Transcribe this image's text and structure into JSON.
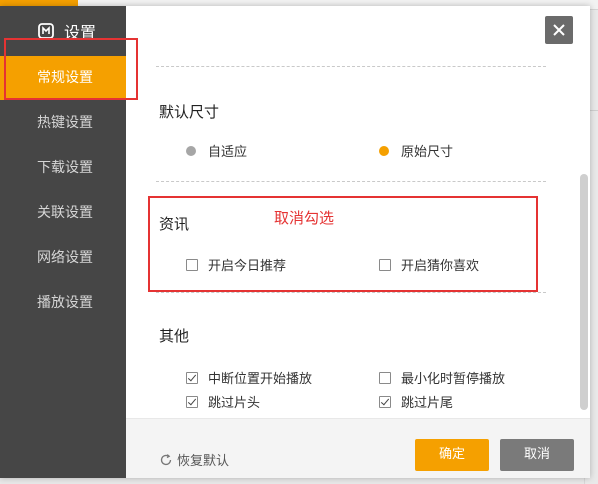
{
  "sidebar": {
    "title": "设置",
    "items": [
      {
        "label": "常规设置"
      },
      {
        "label": "热键设置"
      },
      {
        "label": "下载设置"
      },
      {
        "label": "关联设置"
      },
      {
        "label": "网络设置"
      },
      {
        "label": "播放设置"
      }
    ]
  },
  "sections": {
    "size": {
      "title": "默认尺寸",
      "options": [
        {
          "label": "自适应",
          "selected": false
        },
        {
          "label": "原始尺寸",
          "selected": true
        }
      ]
    },
    "news": {
      "title": "资讯",
      "annotation": "取消勾选",
      "options": [
        {
          "label": "开启今日推荐",
          "checked": false
        },
        {
          "label": "开启猜你喜欢",
          "checked": false
        }
      ]
    },
    "other": {
      "title": "其他",
      "options": [
        {
          "label": "中断位置开始播放",
          "checked": true
        },
        {
          "label": "最小化时暂停播放",
          "checked": false
        },
        {
          "label": "跳过片头",
          "checked": true
        },
        {
          "label": "跳过片尾",
          "checked": true
        }
      ]
    }
  },
  "footer": {
    "restore_label": "恢复默认",
    "ok_label": "确定",
    "cancel_label": "取消"
  },
  "colors": {
    "accent": "#f5a000",
    "sidebar_bg": "#464646",
    "annotation": "#e53333",
    "radio_off": "#a6a6a6"
  },
  "icons": {
    "logo": "app-logo-icon",
    "close": "close-icon",
    "restore": "refresh-icon"
  }
}
